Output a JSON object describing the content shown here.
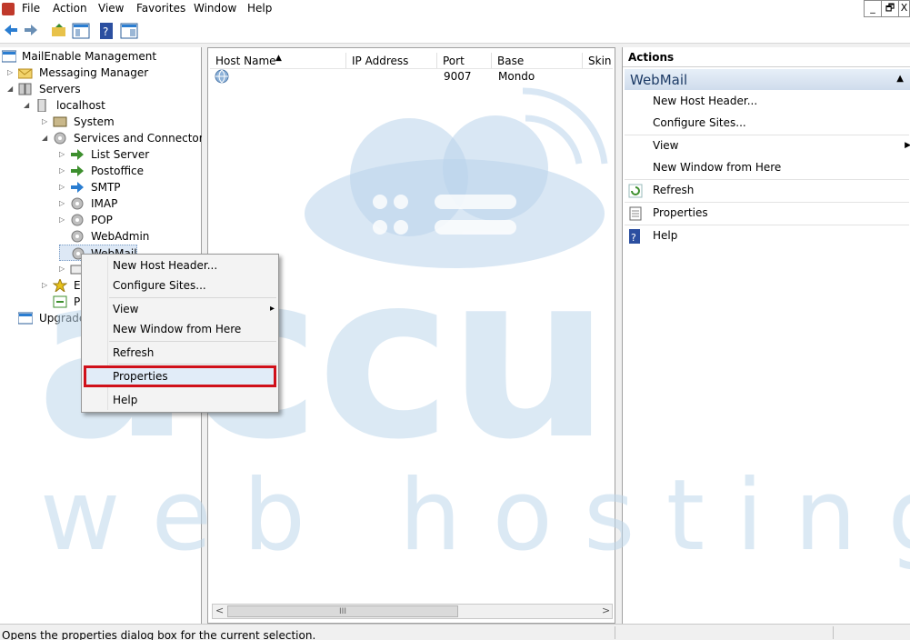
{
  "menu": {
    "items": [
      "File",
      "Action",
      "View",
      "Favorites",
      "Window",
      "Help"
    ]
  },
  "window_buttons": {
    "minimize": "_",
    "restore": "🗗",
    "close": "X"
  },
  "tree": {
    "nodes": [
      {
        "label": "MailEnable Management",
        "icon": "console-icon"
      },
      {
        "label": "Messaging Manager",
        "icon": "messaging-icon"
      },
      {
        "label": "Servers",
        "icon": "servers-icon"
      },
      {
        "label": "localhost",
        "icon": "server-icon"
      },
      {
        "label": "System",
        "icon": "system-icon"
      },
      {
        "label": "Services and Connectors",
        "icon": "gear-icon"
      },
      {
        "label": "List Server",
        "icon": "connector-icon"
      },
      {
        "label": "Postoffice",
        "icon": "connector-icon"
      },
      {
        "label": "SMTP",
        "icon": "connector-icon"
      },
      {
        "label": "IMAP",
        "icon": "gear-icon"
      },
      {
        "label": "POP",
        "icon": "gear-icon"
      },
      {
        "label": "WebAdmin",
        "icon": "gear-icon"
      },
      {
        "label": "WebMail",
        "icon": "gear-icon"
      },
      {
        "label": "",
        "icon": "mail-icon"
      },
      {
        "label": "Ex",
        "icon": "extensions-icon"
      },
      {
        "label": "P",
        "icon": "properties-icon"
      },
      {
        "label": "Upgrade",
        "icon": "upgrade-icon"
      }
    ]
  },
  "list": {
    "columns": [
      "Host Name",
      "IP Address",
      "Port",
      "Base",
      "Skin"
    ],
    "rows": [
      {
        "host": "",
        "ip": "",
        "port": "9007",
        "base": "Mondo",
        "skin": ""
      }
    ],
    "scroll_left": "<",
    "scroll_right": ">",
    "scroll_thumb": "III"
  },
  "actions": {
    "title": "Actions",
    "section": "WebMail",
    "section_arrow": "▲",
    "items": [
      {
        "label": "New Host Header...",
        "icon": ""
      },
      {
        "label": "Configure Sites...",
        "icon": ""
      },
      {
        "label": "View",
        "icon": "",
        "submenu": "▶"
      },
      {
        "label": "New Window from Here",
        "icon": ""
      },
      {
        "label": "Refresh",
        "icon": "refresh-icon"
      },
      {
        "label": "Properties",
        "icon": "properties-icon"
      },
      {
        "label": "Help",
        "icon": "help-icon"
      }
    ]
  },
  "context_menu": {
    "items": [
      "New Host Header...",
      "Configure Sites...",
      "View",
      "New Window from Here",
      "Refresh",
      "Properties",
      "Help"
    ],
    "submenu_arrow": "▸"
  },
  "status": {
    "text": "Opens the properties dialog box for the current selection."
  },
  "watermark": {
    "brand": "accu",
    "tagline": "w e b   h o s t i n g"
  }
}
